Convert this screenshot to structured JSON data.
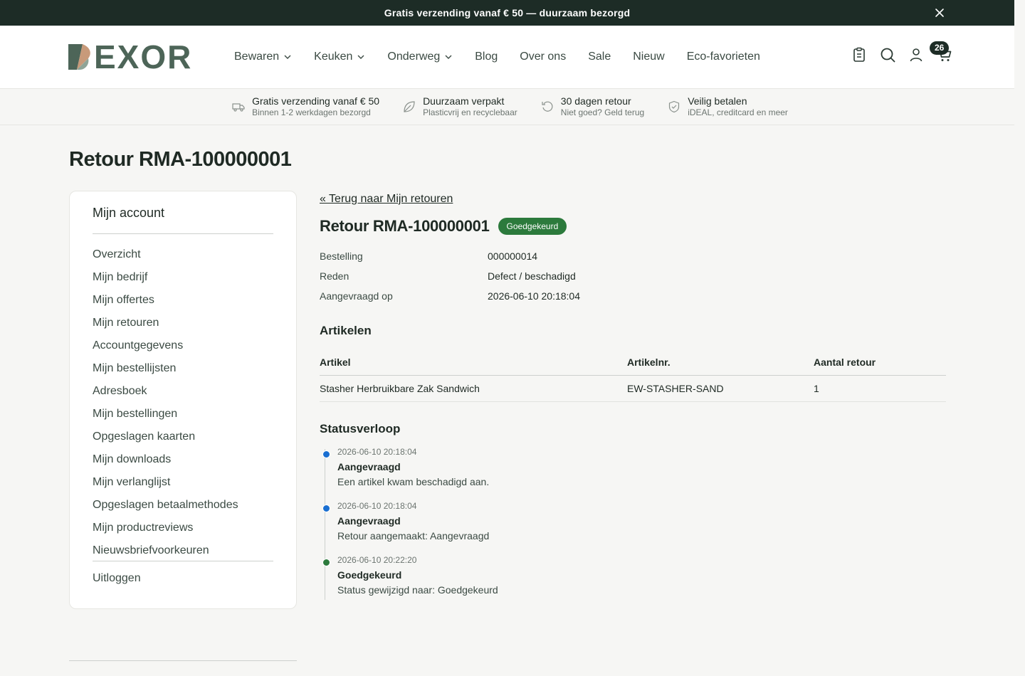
{
  "announcement": {
    "text": "Gratis verzending vanaf € 50 — duurzaam bezorgd"
  },
  "header": {
    "logo_text": "EXOR",
    "nav": [
      {
        "label": "Bewaren",
        "has_dropdown": true
      },
      {
        "label": "Keuken",
        "has_dropdown": true
      },
      {
        "label": "Onderweg",
        "has_dropdown": true
      },
      {
        "label": "Blog",
        "has_dropdown": false
      },
      {
        "label": "Over ons",
        "has_dropdown": false
      },
      {
        "label": "Sale",
        "has_dropdown": false
      },
      {
        "label": "Nieuw",
        "has_dropdown": false
      },
      {
        "label": "Eco-favorieten",
        "has_dropdown": false
      }
    ],
    "icons": [
      "clipboard-icon",
      "search-icon",
      "user-icon",
      "cart-icon"
    ],
    "cart_count": "26"
  },
  "usp": [
    {
      "icon": "truck-icon",
      "title": "Gratis verzending vanaf € 50",
      "sub": "Binnen 1-2 werkdagen bezorgd"
    },
    {
      "icon": "leaf-icon",
      "title": "Duurzaam verpakt",
      "sub": "Plasticvrij en recyclebaar"
    },
    {
      "icon": "return-icon",
      "title": "30 dagen retour",
      "sub": "Niet goed? Geld terug"
    },
    {
      "icon": "shield-icon",
      "title": "Veilig betalen",
      "sub": "iDEAL, creditcard en meer"
    }
  ],
  "page_title": "Retour RMA-100000001",
  "sidebar": {
    "title": "Mijn account",
    "items": [
      "Overzicht",
      "Mijn bedrijf",
      "Mijn offertes",
      "Mijn retouren",
      "Accountgegevens",
      "Mijn bestellijsten",
      "Adresboek",
      "Mijn bestellingen",
      "Opgeslagen kaarten",
      "Mijn downloads",
      "Mijn verlanglijst",
      "Opgeslagen betaalmethodes",
      "Mijn productreviews",
      "Nieuwsbriefvoorkeuren"
    ],
    "logout": "Uitloggen"
  },
  "main": {
    "back_link": "« Terug naar Mijn retouren",
    "rma_title": "Retour RMA-100000001",
    "status_badge": "Goedgekeurd",
    "meta": [
      {
        "label": "Bestelling",
        "value": "000000014"
      },
      {
        "label": "Reden",
        "value": "Defect / beschadigd"
      },
      {
        "label": "Aangevraagd op",
        "value": "2026-06-10 20:18:04"
      }
    ],
    "articles_title": "Artikelen",
    "table": {
      "headers": [
        "Artikel",
        "Artikelnr.",
        "Aantal retour"
      ],
      "rows": [
        [
          "Stasher Herbruikbare Zak Sandwich",
          "EW-STASHER-SAND",
          "1"
        ]
      ]
    },
    "timeline_title": "Statusverloop",
    "timeline": [
      {
        "date": "2026-06-10 20:18:04",
        "status": "Aangevraagd",
        "message": "Een artikel kwam beschadigd aan.",
        "color": "#1a6fd1"
      },
      {
        "date": "2026-06-10 20:18:04",
        "status": "Aangevraagd",
        "message": "Retour aangemaakt: Aangevraagd",
        "color": "#1a6fd1"
      },
      {
        "date": "2026-06-10 20:22:20",
        "status": "Goedgekeurd",
        "message": "Status gewijzigd naar: Goedgekeurd",
        "color": "#2c7a3c"
      }
    ]
  },
  "colors": {
    "brand_dark": "#1d2c26",
    "brand_green": "#4d6558",
    "approved": "#2c7a3c",
    "requested": "#1a6fd1"
  }
}
